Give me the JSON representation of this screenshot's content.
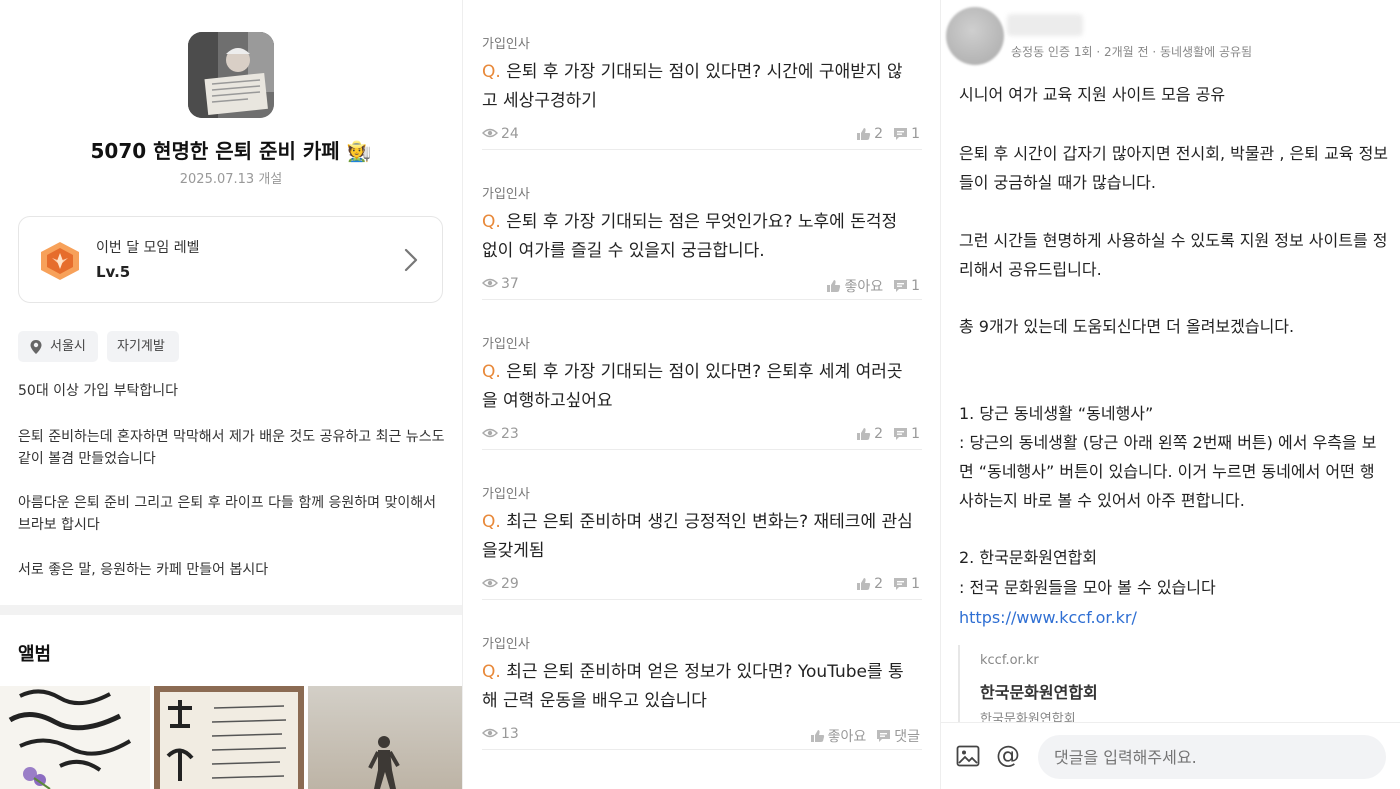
{
  "cafe": {
    "name": "5070 현명한 은퇴 준비 카페 🧑‍🌾",
    "founded": "2025.07.13 개설",
    "level_label": "이번 달 모임 레벨",
    "level_value": "Lv.5",
    "tags": [
      "서울시",
      "자기계발"
    ],
    "description": [
      "50대 이상 가입 부탁합니다",
      "은퇴 준비하는데 혼자하면 막막해서 제가 배운 것도 공유하고 최근 뉴스도 같이 볼겸 만들었습니다",
      "아름다운 은퇴 준비 그리고 은퇴 후 라이프 다들 함께 응원하며 맞이해서 브라보 합시다",
      "서로 좋은 말, 응원하는 카페 만들어 봅시다"
    ],
    "album_title": "앨범"
  },
  "posts": [
    {
      "category": "가입인사",
      "q": "Q.",
      "text": " 은퇴 후 가장 기대되는 점이 있다면? 시간에 구애받지 않고 세상구경하기",
      "views": "24",
      "likes": "2",
      "comments": "1"
    },
    {
      "category": "가입인사",
      "q": "Q.",
      "text": " 은퇴 후 가장 기대되는 점은 무엇인가요? 노후에 돈걱정 없이 여가를 즐길 수 있을지 궁금합니다.",
      "views": "37",
      "likes": "좋아요",
      "comments": "1"
    },
    {
      "category": "가입인사",
      "q": "Q.",
      "text": " 은퇴 후 가장 기대되는 점이 있다면? 은퇴후 세계 여러곳을 여행하고싶어요",
      "views": "23",
      "likes": "2",
      "comments": "1"
    },
    {
      "category": "가입인사",
      "q": "Q.",
      "text": " 최근 은퇴 준비하며 생긴 긍정적인 변화는? 재테크에 관심을갖게됨",
      "views": "29",
      "likes": "2",
      "comments": "1"
    },
    {
      "category": "가입인사",
      "q": "Q.",
      "text": " 최근 은퇴 준비하며 얻은 정보가 있다면? YouTube를 통해 근력 운동을 배우고 있습니다",
      "views": "13",
      "likes": "좋아요",
      "comments": "댓글"
    }
  ],
  "article": {
    "author_meta": "송정동 인증 1회 · 2개월 전 · 동네생활에 공유됨",
    "title": "시니어 여가 교육 지원 사이트 모음 공유",
    "para1": "은퇴 후 시간이 갑자기 많아지면 전시회, 박물관 , 은퇴 교육 정보들이 궁금하실 때가 많습니다.",
    "para2": "그런 시간들 현명하게 사용하실 수 있도록 지원  정보 사이트를 정리해서 공유드립니다.",
    "para3": "총 9개가 있는데 도움되신다면 더 올려보겠습니다.",
    "item1_title": "1. 당근 동네생활 “동네행사”",
    "item1_body": ": 당근의 동네생활 (당근 아래 왼쪽 2번째 버튼) 에서 우측을 보면 “동네행사” 버튼이 있습니다. 이거 누르면 동네에서 어떤 행사하는지 바로 볼 수 있어서 아주 편합니다.",
    "item2_title": "2. 한국문화원연합회",
    "item2_body": ": 전국 문화원들을 모아 볼 수 있습니다",
    "item2_link": "https://www.kccf.or.kr/",
    "link_card": {
      "domain": "kccf.or.kr",
      "title": "한국문화원연합회",
      "desc": "한국문화원연합회"
    },
    "comment_placeholder": "댓글을 입력해주세요."
  }
}
